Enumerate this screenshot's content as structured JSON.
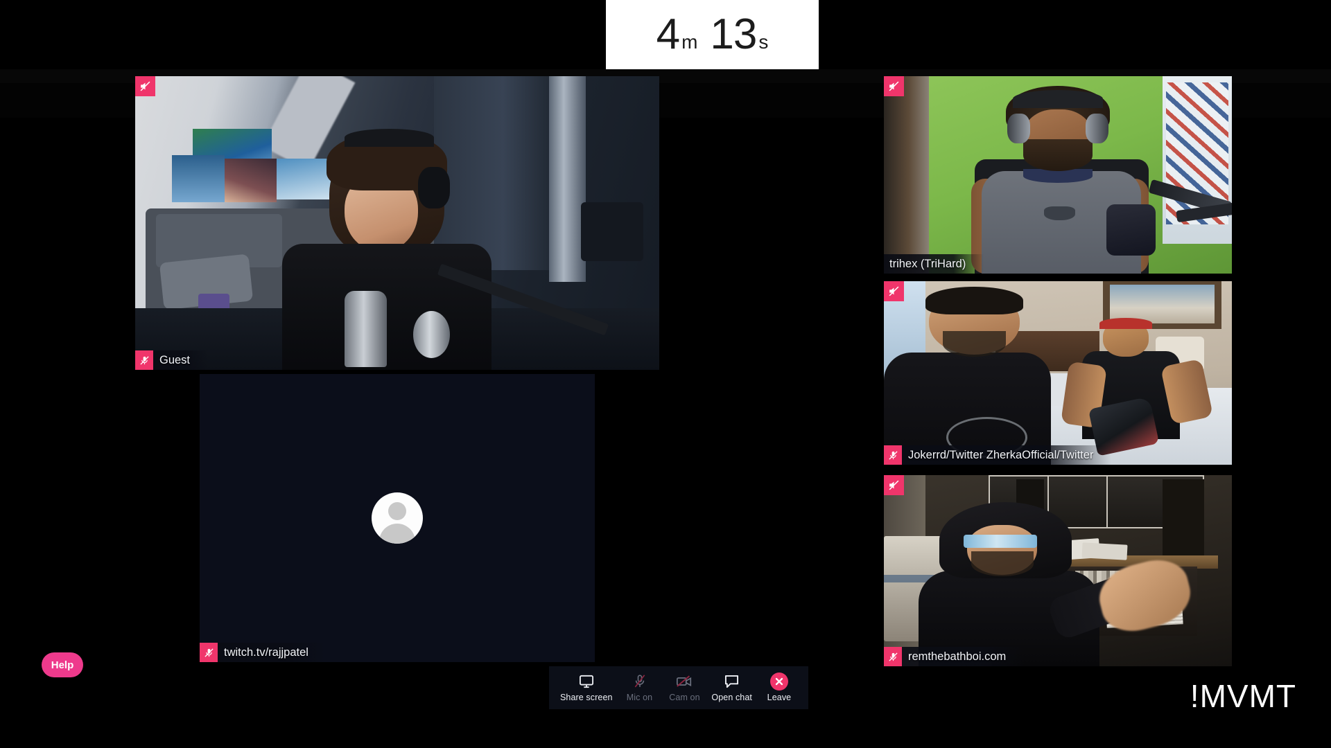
{
  "timer": {
    "minutes": "4",
    "minutes_unit": "m",
    "seconds": "13",
    "seconds_unit": "s",
    "full": "4m 13s"
  },
  "participants": [
    {
      "id": "guest",
      "name": "Guest",
      "mic_icon": "mic-muted-icon",
      "speaker_icon": "speaker-muted-icon",
      "mic_muted": true,
      "has_video": true
    },
    {
      "id": "rajjpatel",
      "name": "twitch.tv/rajjpatel",
      "mic_icon": "mic-muted-icon",
      "speaker_icon": "speaker-muted-icon",
      "mic_muted": true,
      "has_video": false,
      "avatar_icon": "default-avatar-icon"
    },
    {
      "id": "trihex",
      "name": "trihex (TriHard)",
      "mic_icon": "mic-muted-icon",
      "speaker_icon": "speaker-muted-icon",
      "mic_muted": false,
      "has_video": true
    },
    {
      "id": "jokerrd",
      "name": "Jokerrd/Twitter ZherkaOfficial/Twitter",
      "mic_icon": "mic-muted-icon",
      "speaker_icon": "speaker-muted-icon",
      "mic_muted": true,
      "has_video": true
    },
    {
      "id": "remthebathboi",
      "name": "remthebathboi.com",
      "mic_icon": "mic-muted-icon",
      "speaker_icon": "speaker-muted-icon",
      "mic_muted": true,
      "has_video": true
    }
  ],
  "toolbar": {
    "share_screen_label": "Share screen",
    "share_screen_icon": "monitor-icon",
    "mic_label": "Mic on",
    "mic_icon": "mic-muted-icon",
    "mic_state": "off",
    "cam_label": "Cam on",
    "cam_icon": "camera-muted-icon",
    "cam_state": "off",
    "chat_label": "Open chat",
    "chat_icon": "speech-bubble-icon",
    "leave_label": "Leave",
    "leave_icon": "close-x-icon"
  },
  "help": {
    "label": "Help"
  },
  "watermark": {
    "text": "!MVMT"
  },
  "colors": {
    "accent_pink": "#f0356b",
    "help_pink": "#ee3a8c",
    "toolbar_bg": "#0c0f18",
    "stage_bg": "#000000",
    "timer_bg": "#ffffff",
    "label_text": "#f2f4f8",
    "disabled_text": "#6a6f7d"
  }
}
